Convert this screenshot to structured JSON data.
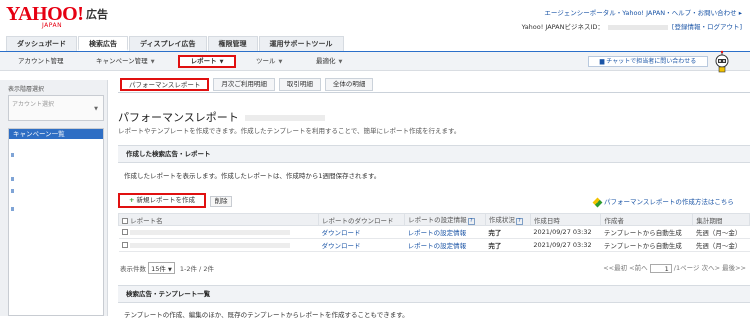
{
  "header": {
    "logo_text": "YAHOO!",
    "logo_sub": "JAPAN",
    "logo_product": "広告",
    "top_links": "エージェンシーポータル・Yahoo! JAPAN・ヘルプ・お問い合わせ ▸",
    "user_prefix": "Yahoo! JAPANビジネスID：",
    "user_links": "[登録情報・ログアウト]"
  },
  "main_tabs": [
    {
      "label": "ダッシュボード"
    },
    {
      "label": "検索広告"
    },
    {
      "label": "ディスプレイ広告"
    },
    {
      "label": "権限管理"
    },
    {
      "label": "運用サポートツール"
    }
  ],
  "submenu": {
    "account": "アカウント管理",
    "campaign": "キャンペーン管理",
    "report": "レポート",
    "tools": "ツール",
    "optimize": "最適化",
    "chat": "チャットで担当者に問い合わせる"
  },
  "sidebar": {
    "label": "表示階層選択",
    "select_placeholder": "アカウント選択",
    "list_first": "キャンペーン一覧"
  },
  "content_tabs": [
    {
      "label": "パフォーマンスレポート"
    },
    {
      "label": "月次ご利用明細"
    },
    {
      "label": "取引明細"
    },
    {
      "label": "全体の明細"
    }
  ],
  "page": {
    "title": "パフォーマンスレポート",
    "desc": "レポートやテンプレートを作成できます。作成したテンプレートを利用することで、簡単にレポート作成を行えます。"
  },
  "section1": {
    "title": "作成した検索広告・レポート",
    "desc": "作成したレポートを表示します。作成したレポートは、作成時から1週間保存されます。",
    "new_button": "新規レポートを作成",
    "delete_button": "削除",
    "howto_link": "パフォーマンスレポートの作成方法はこちら"
  },
  "table": {
    "headers": [
      "レポート名",
      "レポートのダウンロード",
      "レポートの設定情報",
      "作成状況",
      "作成日時",
      "作成者",
      "集計期間"
    ],
    "rows": [
      {
        "download": "ダウンロード",
        "settings": "レポートの設定情報",
        "status": "完了",
        "date": "2021/09/27 03:32",
        "creator": "テンプレートから自動生成",
        "period": "先週（月〜金）"
      },
      {
        "download": "ダウンロード",
        "settings": "レポートの設定情報",
        "status": "完了",
        "date": "2021/09/27 03:32",
        "creator": "テンプレートから自動生成",
        "period": "先週（月〜金）"
      }
    ]
  },
  "pager": {
    "count_label": "表示件数",
    "count_value": "15件",
    "range": "1-2件 / 2件",
    "first": "<<最初",
    "prev": "<前へ",
    "page": "1",
    "total": "/1ページ",
    "next": "次へ>",
    "last": "最後>>"
  },
  "section2": {
    "title": "検索広告・テンプレート一覧",
    "desc": "テンプレートの作成、編集のほか、既存のテンプレートからレポートを作成することもできます。"
  }
}
